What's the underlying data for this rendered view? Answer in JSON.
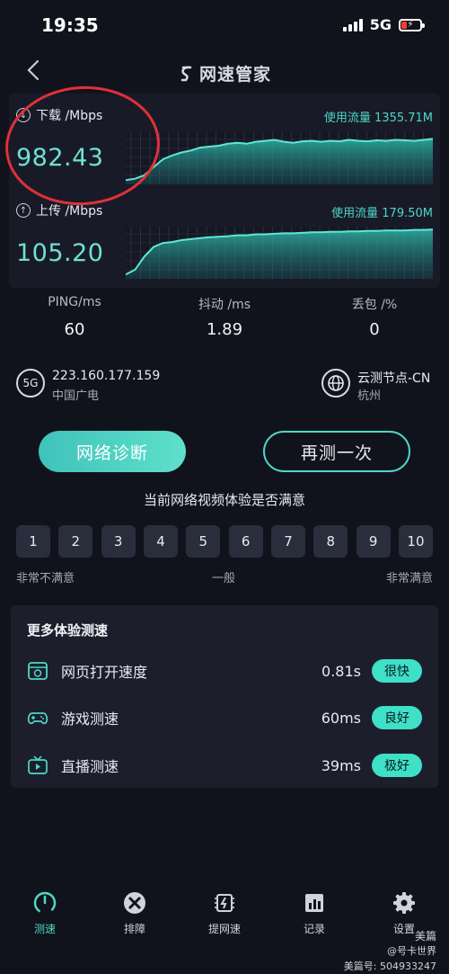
{
  "status_bar": {
    "time": "19:35",
    "network": "5G"
  },
  "header": {
    "title": "网速管家"
  },
  "download": {
    "label": "下载 /Mbps",
    "usage": "使用流量 1355.71M",
    "speed": "982.43",
    "graph_levels": [
      0.05,
      0.08,
      0.15,
      0.32,
      0.48,
      0.56,
      0.62,
      0.66,
      0.72,
      0.74,
      0.76,
      0.8,
      0.82,
      0.8,
      0.84,
      0.86,
      0.88,
      0.84,
      0.82,
      0.85,
      0.86,
      0.84,
      0.86,
      0.85,
      0.88,
      0.86,
      0.85,
      0.87,
      0.86,
      0.88,
      0.87,
      0.86,
      0.88,
      0.9
    ]
  },
  "upload": {
    "label": "上传 /Mbps",
    "usage": "使用流量 179.50M",
    "speed": "105.20",
    "graph_levels": [
      0.05,
      0.15,
      0.42,
      0.62,
      0.7,
      0.72,
      0.76,
      0.78,
      0.8,
      0.82,
      0.83,
      0.84,
      0.86,
      0.86,
      0.88,
      0.88,
      0.89,
      0.9,
      0.9,
      0.91,
      0.92,
      0.92,
      0.93,
      0.93,
      0.94,
      0.94,
      0.95,
      0.95,
      0.96,
      0.96,
      0.96,
      0.97,
      0.97,
      0.98
    ]
  },
  "stats": [
    {
      "label": "PING/ms",
      "value": "60"
    },
    {
      "label": "抖动 /ms",
      "value": "1.89"
    },
    {
      "label": "丢包 /%",
      "value": "0"
    }
  ],
  "connection": {
    "badge": "5G",
    "ip": "223.160.177.159",
    "carrier": "中国广电"
  },
  "node": {
    "name": "云测节点-CN",
    "city": "杭州"
  },
  "buttons": {
    "diagnose": "网络诊断",
    "retest": "再测一次"
  },
  "rating": {
    "question": "当前网络视频体验是否满意",
    "scale": [
      "1",
      "2",
      "3",
      "4",
      "5",
      "6",
      "7",
      "8",
      "9",
      "10"
    ],
    "low_label": "非常不满意",
    "mid_label": "一般",
    "high_label": "非常满意"
  },
  "more_tests": {
    "title": "更多体验测速",
    "items": [
      {
        "name": "网页打开速度",
        "value": "0.81s",
        "badge": "很快",
        "icon": "webpage-icon"
      },
      {
        "name": "游戏测速",
        "value": "60ms",
        "badge": "良好",
        "icon": "gamepad-icon"
      },
      {
        "name": "直播测速",
        "value": "39ms",
        "badge": "极好",
        "icon": "tv-icon"
      }
    ]
  },
  "nav": [
    {
      "label": "测速",
      "icon": "gauge-icon",
      "active": true
    },
    {
      "label": "排障",
      "icon": "tools-icon",
      "active": false
    },
    {
      "label": "提网速",
      "icon": "chip-icon",
      "active": false
    },
    {
      "label": "记录",
      "icon": "bar-chart-icon",
      "active": false
    },
    {
      "label": "设置",
      "icon": "gear-icon",
      "active": false
    }
  ],
  "watermarks": {
    "line1": "美篇",
    "line2": "@号卡世界",
    "line3": "美篇号: 504933247"
  },
  "colors": {
    "accent": "#4fd6c8",
    "background": "#11131c",
    "highlight_ring": "#e0303a"
  }
}
